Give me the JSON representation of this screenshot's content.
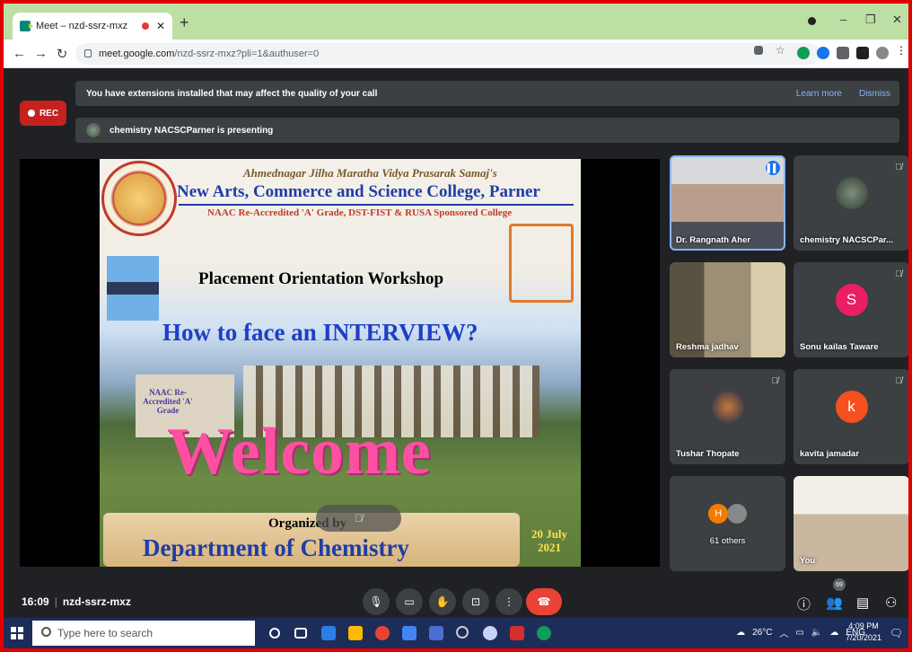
{
  "browser": {
    "tab_title": "Meet – nzd-ssrz-mxz",
    "url_host": "meet.google.com",
    "url_path": "/nzd-ssrz-mxz?pli=1&authuser=0"
  },
  "banner": {
    "message": "You have extensions installed that may affect the quality of your call",
    "learn_more": "Learn more",
    "dismiss": "Dismiss"
  },
  "rec_label": "REC",
  "presenting": "chemistry NACSCParner is presenting",
  "slide": {
    "society": "Ahmednagar Jilha Maratha Vidya Prasarak Samaj's",
    "college": "New Arts, Commerce and Science College, Parner",
    "accreditation": "NAAC Re-Accredited 'A' Grade, DST-FIST & RUSA Sponsored College",
    "workshop": "Placement Orientation Workshop",
    "topic": "How to face an INTERVIEW?",
    "naac_badge": "NAAC Re-Accredited 'A' Grade",
    "welcome": "Welcome",
    "organized_by": "Organized by",
    "department": "Department of Chemistry",
    "date": "20 July 2021"
  },
  "participants": [
    {
      "name": "Dr. Rangnath Aher"
    },
    {
      "name": "chemistry NACSCPar..."
    },
    {
      "name": "Reshma jadhav"
    },
    {
      "name": "Sonu kailas Taware",
      "initial": "S",
      "color": "#e91e63"
    },
    {
      "name": "Tushar Thopate"
    },
    {
      "name": "kavita jamadar",
      "initial": "k",
      "color": "#f4511e"
    },
    {
      "name": "61 others",
      "initial": "H",
      "color": "#f57c00"
    },
    {
      "name": "You"
    }
  ],
  "bottom": {
    "time": "16:09",
    "meeting_code": "nzd-ssrz-mxz",
    "participant_count": "69"
  },
  "taskbar": {
    "search_placeholder": "Type here to search",
    "weather": "26°C",
    "lang": "ENG",
    "time": "4:09 PM",
    "date": "7/20/2021"
  }
}
